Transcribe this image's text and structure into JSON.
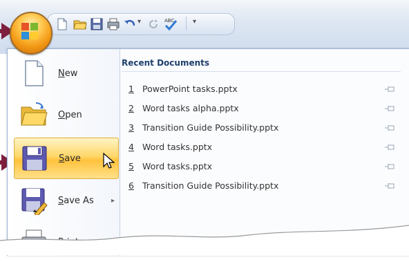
{
  "quick_access": {
    "icons": [
      "new-document-icon",
      "open-folder-icon",
      "save-disk-icon",
      "print-icon",
      "undo-icon",
      "redo-icon",
      "spelling-check-icon",
      "customize-qat-icon"
    ]
  },
  "office_button": {
    "icon": "office-logo-icon"
  },
  "menu": {
    "commands": [
      {
        "label": "New",
        "icon": "new-document-icon",
        "has_submenu": false
      },
      {
        "label": "Open",
        "icon": "open-folder-icon",
        "has_submenu": false
      },
      {
        "label": "Save",
        "icon": "save-disk-icon",
        "has_submenu": false,
        "active": true
      },
      {
        "label": "Save As",
        "icon": "save-as-icon",
        "has_submenu": true
      },
      {
        "label": "Print",
        "icon": "printer-icon",
        "has_submenu": true
      }
    ],
    "submenu_arrow": "▸"
  },
  "recent": {
    "title": "Recent Documents",
    "items": [
      {
        "num": "1",
        "name": "PowerPoint tasks.pptx"
      },
      {
        "num": "2",
        "name": "Word tasks alpha.pptx"
      },
      {
        "num": "3",
        "name": "Transition Guide Possibility.pptx"
      },
      {
        "num": "4",
        "name": "Word tasks.pptx"
      },
      {
        "num": "5",
        "name": "Word tasks.pptx"
      },
      {
        "num": "6",
        "name": "Transition Guide Possibility.pptx"
      }
    ]
  },
  "colors": {
    "arrow": "#7d1f3d",
    "highlight": "#ffc23c",
    "heading": "#1f3f6b"
  }
}
